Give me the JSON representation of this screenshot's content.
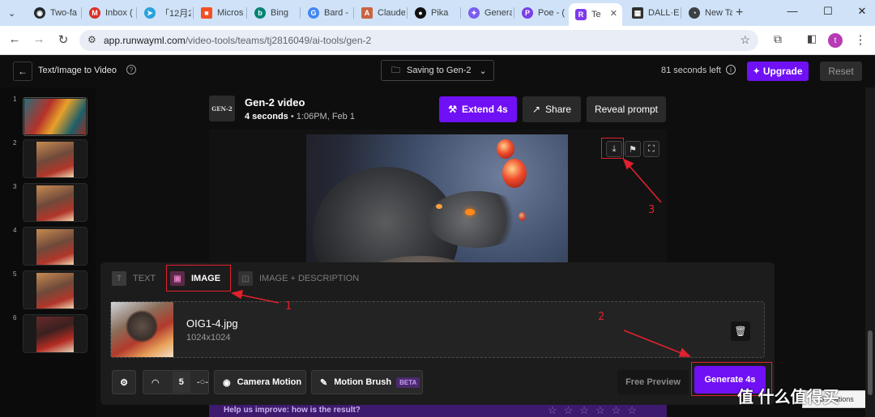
{
  "browser": {
    "tabs": [
      {
        "label": "Two-fa",
        "icon_color": "#24292f",
        "icon_glyph": "◉"
      },
      {
        "label": "Inbox (",
        "icon_color": "#d93025",
        "icon_glyph": "M"
      },
      {
        "label": "「12月2",
        "icon_color": "#2aa1da",
        "icon_glyph": "➤"
      },
      {
        "label": "Micros",
        "icon_color": "#f25022",
        "icon_glyph": "■"
      },
      {
        "label": "Bing",
        "icon_color": "#008373",
        "icon_glyph": "b"
      },
      {
        "label": "Bard -",
        "icon_color": "#4285f4",
        "icon_glyph": "G"
      },
      {
        "label": "Claude",
        "icon_color": "#c96442",
        "icon_glyph": "A"
      },
      {
        "label": "Pika",
        "icon_color": "#111111",
        "icon_glyph": "●"
      },
      {
        "label": "Genera",
        "icon_color": "#7a5cf0",
        "icon_glyph": "✦"
      },
      {
        "label": "Poe - (",
        "icon_color": "#7b3fe4",
        "icon_glyph": "P"
      },
      {
        "label": "Te",
        "icon_color": "#7c3aed",
        "icon_glyph": "R"
      },
      {
        "label": "DALL·E",
        "icon_color": "#2f2f2f",
        "icon_glyph": "▦"
      },
      {
        "label": "New Ta",
        "icon_color": "#3c4043",
        "icon_glyph": "◔"
      }
    ],
    "new_tab_label": "+",
    "url_host": "app.runwayml.com",
    "url_path": "/video-tools/teams/tj2816049/ai-tools/gen-2",
    "profile_initial": "t"
  },
  "header": {
    "title": "Text/Image to Video",
    "saving_label": "Saving to Gen-2",
    "time_left": "81 seconds left",
    "upgrade_label": "Upgrade",
    "reset_label": "Reset"
  },
  "sidebar": {
    "items": [
      "1",
      "2",
      "3",
      "4",
      "5",
      "6"
    ]
  },
  "video": {
    "badge": "GEN-2",
    "title": "Gen-2 video",
    "duration": "4 seconds",
    "timestamp": "1:06PM, Feb 1",
    "extend_label": "Extend 4s",
    "share_label": "Share",
    "reveal_label": "Reveal prompt"
  },
  "panel": {
    "tabs": [
      {
        "label": "TEXT",
        "glyph": "T"
      },
      {
        "label": "IMAGE",
        "glyph": "▣"
      },
      {
        "label": "IMAGE + DESCRIPTION",
        "glyph": "◫"
      }
    ],
    "file_name": "OIG1-4.jpg",
    "file_dims": "1024x1024",
    "seed_value": "5",
    "camera_motion_label": "Camera Motion",
    "motion_brush_label": "Motion Brush",
    "beta_label": "BETA",
    "free_preview_label": "Free Preview",
    "generate_label": "Generate 4s",
    "feedback_text": "Help us improve: how is the result?",
    "credits_text": "5 ... ations"
  },
  "annotations": [
    "1",
    "2",
    "3"
  ],
  "watermark": "值 什么值得买",
  "colors": {
    "accent": "#7010f5",
    "annotation_red": "#e0212e",
    "tab_strip": "#cfe2f8"
  }
}
